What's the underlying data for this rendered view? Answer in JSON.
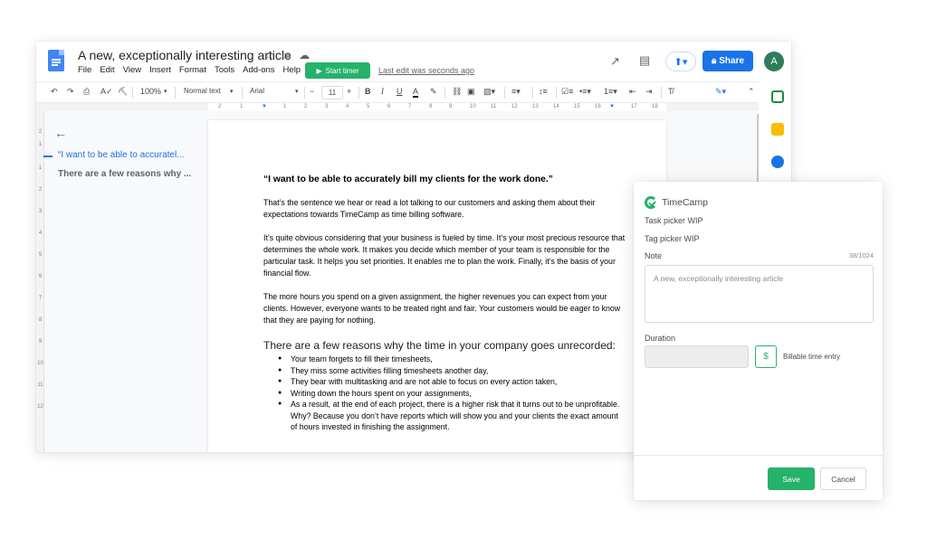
{
  "docs": {
    "title": "A new, exceptionally interesting article",
    "menu": [
      "File",
      "Edit",
      "View",
      "Insert",
      "Format",
      "Tools",
      "Add-ons",
      "Help"
    ],
    "start_timer_label": "Start timer",
    "last_edit": "Last edit was seconds ago",
    "share_label": "Share",
    "avatar_initial": "A"
  },
  "toolbar": {
    "zoom": "100%",
    "style": "Normal text",
    "font": "Arial",
    "font_size": "11"
  },
  "ruler": {
    "numbers": [
      "2",
      "1",
      "1",
      "2",
      "3",
      "4",
      "5",
      "6",
      "7",
      "8",
      "9",
      "10",
      "11",
      "12",
      "13",
      "14",
      "15",
      "16",
      "17",
      "18"
    ]
  },
  "vruler": {
    "numbers": [
      "2",
      "1",
      "1",
      "2",
      "3",
      "4",
      "5",
      "6",
      "7",
      "8",
      "9",
      "10",
      "11",
      "12"
    ]
  },
  "outline": {
    "item1": "“I want to be able to accuratel...",
    "item2": "There are a few reasons why ..."
  },
  "document": {
    "heading": "“I want to be able to accurately bill my clients for the work done.”",
    "p1": "That’s the sentence we hear or read a lot talking to our customers and asking them about their expectations towards TimeCamp as time billing software.",
    "p2": "It’s quite obvious considering that your business is fueled by time. It’s your most precious resource that determines the whole work. It makes you decide which member of your team is responsible for the particular task. It helps you set priorities. It enables me to plan the work. Finally, it’s the basis of your financial flow.",
    "p3": "The more hours you spend on a given assignment, the higher revenues you can expect from your clients. However, everyone wants to be treated right and fair. Your customers would be eager to know that they are paying for nothing.",
    "h2": "There are a few reasons why the time in your company goes unrecorded:",
    "bullets": [
      "Your team forgets to fill their timesheets,",
      "They miss some activities filling timesheets another day,",
      "They bear with multitasking and are not able to focus on every action taken,",
      "Writing down the hours spent on your assignments,",
      "As a result, at the end of each project, there is a higher risk that it turns out to be unprofitable. Why? Because you don’t have reports which will show you and your clients the exact amount of hours invested in finishing the assignment."
    ]
  },
  "timecamp": {
    "brand": "TimeCamp",
    "task_picker": "Task picker WIP",
    "tag_picker": "Tag picker WIP",
    "note_label": "Note",
    "note_counter": "38/1024",
    "note_value": "A new, exceptionally interesting article",
    "duration_label": "Duration",
    "dollar": "$",
    "billable_label": "Billable time entry",
    "save_label": "Save",
    "cancel_label": "Cancel",
    "accent_color": "#25b26a"
  },
  "colors": {
    "docs_blue": "#1a73e8",
    "timecamp_green": "#25b26a"
  }
}
